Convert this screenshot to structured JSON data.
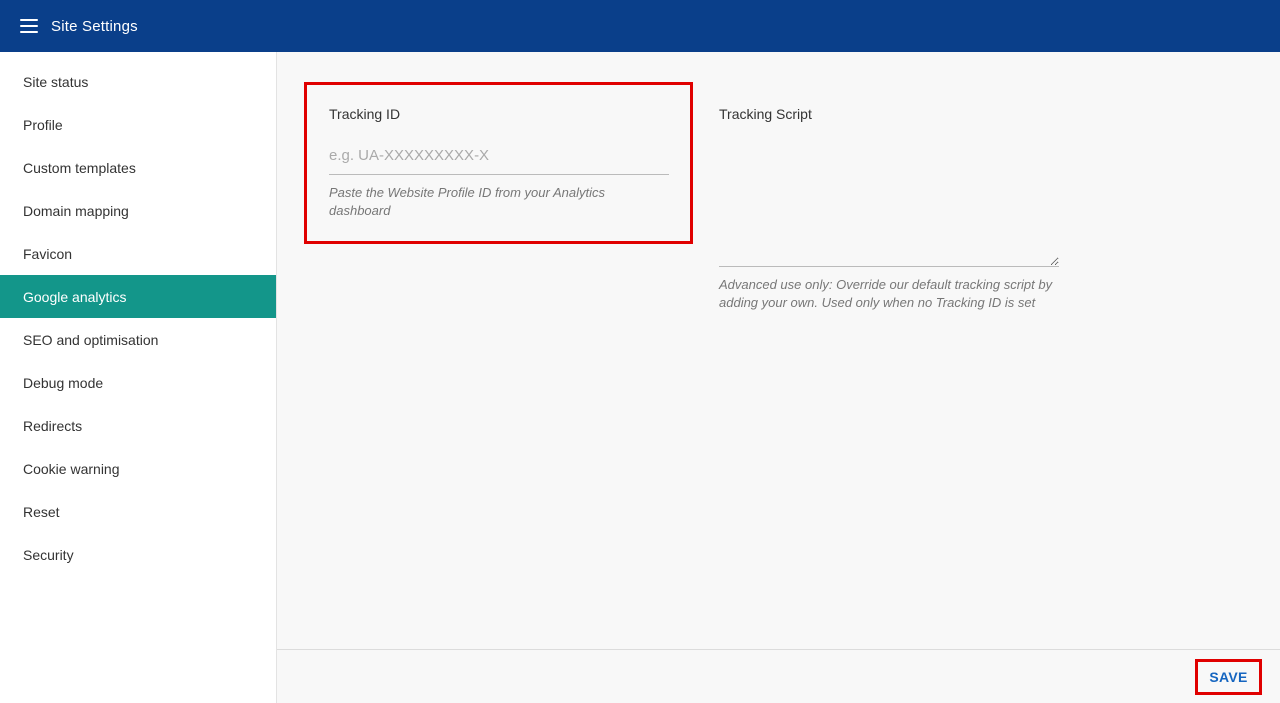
{
  "app": {
    "title": "Site Settings",
    "brand_color": "#0a3f8a",
    "accent_color": "#13968a"
  },
  "sidebar": {
    "items": [
      {
        "label": "Site status"
      },
      {
        "label": "Profile"
      },
      {
        "label": "Custom templates"
      },
      {
        "label": "Domain mapping"
      },
      {
        "label": "Favicon"
      },
      {
        "label": "Google analytics",
        "active": true
      },
      {
        "label": "SEO and optimisation"
      },
      {
        "label": "Debug mode"
      },
      {
        "label": "Redirects"
      },
      {
        "label": "Cookie warning"
      },
      {
        "label": "Reset"
      },
      {
        "label": "Security"
      }
    ]
  },
  "form": {
    "tracking_id": {
      "label": "Tracking ID",
      "value": "",
      "placeholder": "e.g. UA-XXXXXXXXX-X",
      "help": "Paste the Website Profile ID from your Analytics dashboard"
    },
    "tracking_script": {
      "label": "Tracking Script",
      "value": "",
      "help": "Advanced use only: Override our default tracking script by adding your own. Used only when no Tracking ID is set"
    }
  },
  "footer": {
    "save_label": "SAVE"
  }
}
